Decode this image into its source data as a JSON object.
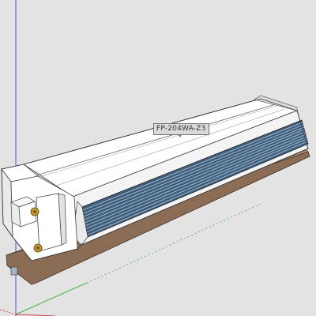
{
  "scene": {
    "model_tag": "FP-204WA-Z3",
    "component_icon": "fan-coil-unit-icon",
    "colors": {
      "background": "#e3e3e3",
      "casing": "#ffffff",
      "coil": "#3e5e7c",
      "base": "#8b6c55",
      "axis_red": "#d94040",
      "axis_green": "#4cae4c",
      "axis_blue": "#5050d8",
      "valve_brass": "#c99a2e"
    }
  }
}
